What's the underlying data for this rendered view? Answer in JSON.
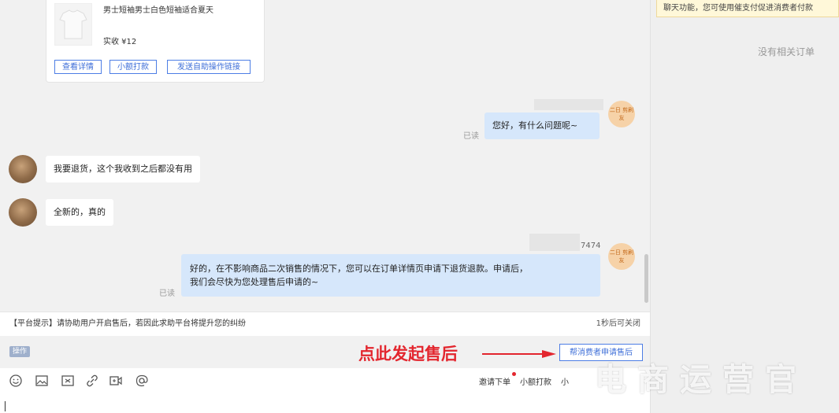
{
  "notice": {
    "text": "聊天功能，您可使用催支付促进消费者付款"
  },
  "orders_panel": {
    "empty_text": "没有相关订单"
  },
  "product_card": {
    "name": "男士短袖男士白色短袖适合夏天",
    "price": "实收 ¥12",
    "buttons": [
      "查看详情",
      "小额打款",
      "发送自助操作链接"
    ]
  },
  "messages": [
    {
      "side": "right",
      "text": "您好，有什么问题呢~",
      "read": "已读",
      "badge": "二日 剪刷友"
    },
    {
      "side": "left",
      "text": "我要退货，这个我收到之后都没有用"
    },
    {
      "side": "left",
      "text": "全新的，真的"
    },
    {
      "side": "right",
      "sender_suffix": "7474",
      "line1": "好的，在不影响商品二次销售的情况下，您可以在订单详情页申请下退货退款。申请后，",
      "line2": "我们会尽快为您处理售后申请的~",
      "read": "已读",
      "badge": "二日 剪刷友"
    }
  ],
  "tip_bar": {
    "text": "【平台提示】请协助用户开启售后，若因此求助平台将提升您的纠纷",
    "close": "1秒后可关闭"
  },
  "op_bar": {
    "tag": "操作",
    "annotation": "点此发起售后",
    "aftersale_button": "帮消费者申请售后"
  },
  "toolbar": {
    "icons": [
      "emoji-icon",
      "image-icon",
      "screenshot-icon",
      "link-icon",
      "video-icon",
      "at-icon"
    ],
    "invite_order": "邀请下单",
    "small_pay": "小额打款",
    "more": "小"
  },
  "watermark": "电商运营官"
}
